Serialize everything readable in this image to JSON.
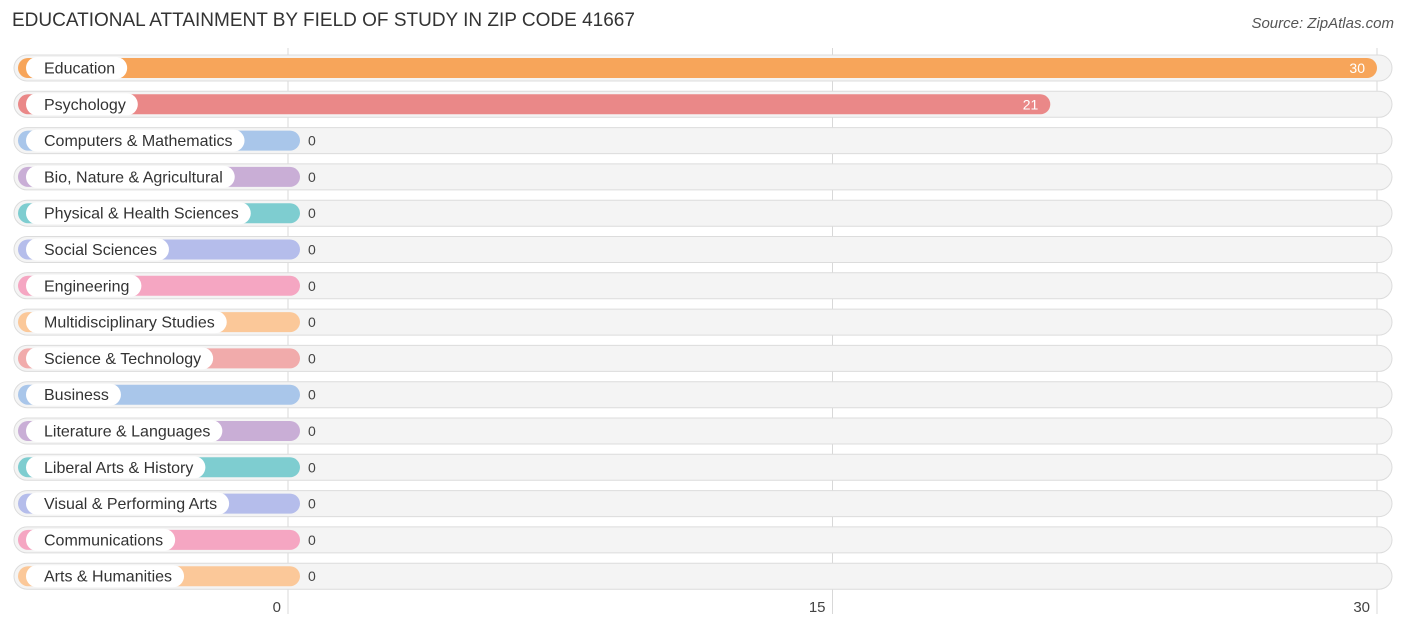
{
  "chart_data": {
    "type": "bar",
    "orientation": "horizontal",
    "title": "EDUCATIONAL ATTAINMENT BY FIELD OF STUDY IN ZIP CODE 41667",
    "source": "Source: ZipAtlas.com",
    "xlabel": "",
    "ylabel": "",
    "xlim": [
      0,
      30
    ],
    "xticks": [
      0,
      15,
      30
    ],
    "grid": true,
    "categories": [
      "Education",
      "Psychology",
      "Computers & Mathematics",
      "Bio, Nature & Agricultural",
      "Physical & Health Sciences",
      "Social Sciences",
      "Engineering",
      "Multidisciplinary Studies",
      "Science & Technology",
      "Business",
      "Literature & Languages",
      "Liberal Arts & History",
      "Visual & Performing Arts",
      "Communications",
      "Arts & Humanities"
    ],
    "values": [
      30,
      21,
      0,
      0,
      0,
      0,
      0,
      0,
      0,
      0,
      0,
      0,
      0,
      0,
      0
    ],
    "colors": [
      "#f7a55a",
      "#ea8888",
      "#a9c6ea",
      "#c9aed6",
      "#7ecdd0",
      "#b5bdeb",
      "#f5a6c2",
      "#fbc899",
      "#f1abab",
      "#a9c6ea",
      "#c9aed6",
      "#7ecdd0",
      "#b5bdeb",
      "#f5a6c2",
      "#fbc899"
    ]
  }
}
